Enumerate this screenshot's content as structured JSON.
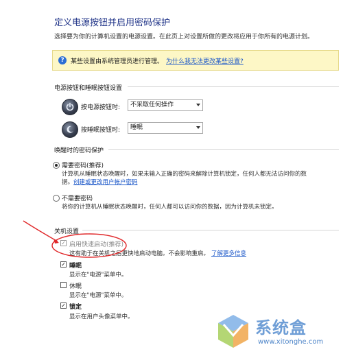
{
  "page": {
    "title": "定义电源按钮并启用密码保护",
    "subtitle": "选择要为你的计算机设置的电源设置。在此页上对设置所做的更改将应用于你所有的电源计划。"
  },
  "banner": {
    "text": "某些设置由系统管理员进行管理。",
    "link": "为什么我无法更改某些设置?"
  },
  "power_section": {
    "header": "电源按钮和睡眠按钮设置",
    "power_button": {
      "label": "按电源按钮时:",
      "value": "不采取任何操作"
    },
    "sleep_button": {
      "label": "按睡眠按钮时:",
      "value": "睡眠"
    }
  },
  "password_section": {
    "header": "唤醒时的密码保护",
    "require": {
      "label": "需要密码(推荐)",
      "desc1": "计算机从睡眠状态唤醒时，如果未输入正确的密码来解除计算机锁定，任何人都无法访问你的数",
      "desc2": "据。",
      "link": "创建或更改用户帐户密码"
    },
    "no_require": {
      "label": "不需要密码",
      "desc": "将你的计算机从睡眠状态唤醒时，任何人都可以访问你的数据，因为计算机未锁定。"
    }
  },
  "shutdown_section": {
    "header": "关机设置",
    "fast_startup": {
      "label": "启用快速启动(推荐)",
      "desc": "这有助于在关机之后更快地启动电脑。不会影响重启。",
      "link": "了解更多信息"
    },
    "sleep": {
      "label": "睡眠",
      "desc": "显示在\"电源\"菜单中。"
    },
    "hibernate": {
      "label": "休眠",
      "desc": "显示在\"电源\"菜单中。"
    },
    "lock": {
      "label": "锁定",
      "desc": "显示在用户头像菜单中。"
    }
  },
  "watermark": {
    "brand": "系统盒",
    "url": "www.xitonghe.com"
  },
  "colors": {
    "title": "#1e3287",
    "link": "#1a56c8",
    "banner_bg": "#fdf7c6",
    "annotation": "#e0282a"
  }
}
